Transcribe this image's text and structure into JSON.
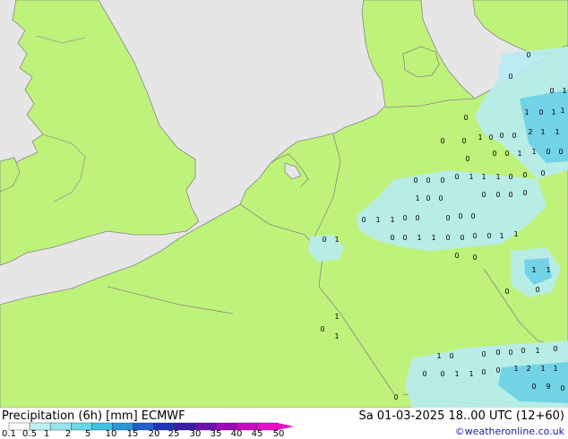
{
  "map": {
    "region": "North Sea / Western Europe",
    "colors": {
      "sea": "#e6e6e6",
      "land": "#bff27a",
      "border": "#888888",
      "precip_light": "#b7ecf2",
      "precip_medium": "#72d3e6",
      "number_text": "#000000"
    },
    "precip_values": [
      {
        "v": "0"
      },
      {
        "v": "0"
      },
      {
        "v": "0"
      },
      {
        "v": "1"
      },
      {
        "v": "1"
      },
      {
        "v": "1"
      },
      {
        "v": "0"
      },
      {
        "v": "1"
      },
      {
        "v": "2"
      },
      {
        "v": "1"
      },
      {
        "v": "1"
      },
      {
        "v": "0"
      },
      {
        "v": "0"
      },
      {
        "v": "0"
      },
      {
        "v": "1"
      },
      {
        "v": "1"
      },
      {
        "v": "0"
      },
      {
        "v": "0"
      },
      {
        "v": "1"
      },
      {
        "v": "0"
      },
      {
        "v": "0"
      },
      {
        "v": "0"
      },
      {
        "v": "0"
      },
      {
        "v": "0"
      },
      {
        "v": "0"
      },
      {
        "v": "1"
      },
      {
        "v": "1"
      },
      {
        "v": "0"
      },
      {
        "v": "0"
      },
      {
        "v": "0"
      },
      {
        "v": "0"
      },
      {
        "v": "0"
      },
      {
        "v": "0"
      },
      {
        "v": "0"
      },
      {
        "v": "1"
      },
      {
        "v": "1"
      },
      {
        "v": "0"
      },
      {
        "v": "0"
      },
      {
        "v": "0"
      },
      {
        "v": "0"
      },
      {
        "v": "0"
      },
      {
        "v": "0"
      },
      {
        "v": "0"
      },
      {
        "v": "1"
      },
      {
        "v": "1"
      },
      {
        "v": "0"
      },
      {
        "v": "0"
      },
      {
        "v": "0"
      },
      {
        "v": "0"
      },
      {
        "v": "0"
      },
      {
        "v": "0"
      },
      {
        "v": "0"
      },
      {
        "v": "1"
      },
      {
        "v": "1"
      },
      {
        "v": "0"
      },
      {
        "v": "0"
      },
      {
        "v": "0"
      },
      {
        "v": "0"
      },
      {
        "v": "1"
      },
      {
        "v": "1"
      },
      {
        "v": "0"
      },
      {
        "v": "1"
      },
      {
        "v": "1"
      },
      {
        "v": "1"
      },
      {
        "v": "0"
      },
      {
        "v": "0"
      },
      {
        "v": "0"
      },
      {
        "v": "0"
      },
      {
        "v": "1"
      },
      {
        "v": "0"
      },
      {
        "v": "1"
      },
      {
        "v": "1"
      },
      {
        "v": "0"
      },
      {
        "v": "0"
      },
      {
        "v": "0"
      },
      {
        "v": "0"
      },
      {
        "v": "0"
      },
      {
        "v": "1"
      },
      {
        "v": "0"
      },
      {
        "v": "0"
      },
      {
        "v": "0"
      },
      {
        "v": "1"
      },
      {
        "v": "1"
      },
      {
        "v": "0"
      },
      {
        "v": "0"
      },
      {
        "v": "1"
      },
      {
        "v": "2"
      },
      {
        "v": "1"
      },
      {
        "v": "1"
      },
      {
        "v": "0"
      },
      {
        "v": "9"
      },
      {
        "v": "0"
      },
      {
        "v": "0"
      }
    ]
  },
  "footer": {
    "title": "Precipitation (6h) [mm] ECMWF",
    "run_info": "Sa 01-03-2025 18..00 UTC (12+60)",
    "credit": "©weatheronline.co.uk",
    "legend": {
      "ticks": [
        "0.1",
        "0.5",
        "1",
        "2",
        "5",
        "10",
        "15",
        "20",
        "25",
        "30",
        "35",
        "40",
        "45",
        "50"
      ],
      "colors": [
        "#fefefe",
        "#bff0f6",
        "#96e4f0",
        "#6dd6ea",
        "#3fc4e4",
        "#2a98d8",
        "#2460c8",
        "#1c34b8",
        "#3a1ca8",
        "#6a10b0",
        "#9a08b8",
        "#c808c0",
        "#e410c8"
      ]
    }
  }
}
